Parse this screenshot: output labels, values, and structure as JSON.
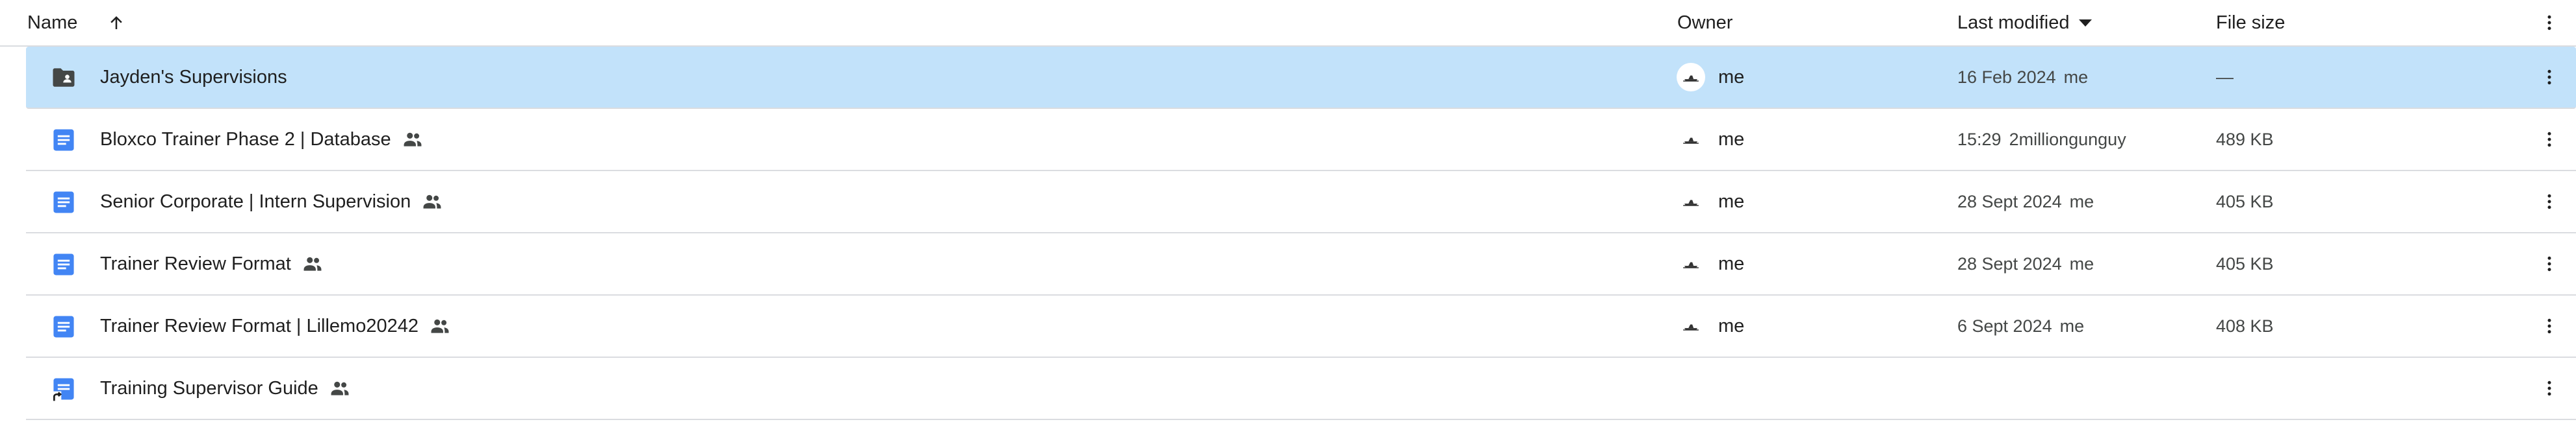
{
  "header": {
    "name_label": "Name",
    "owner_label": "Owner",
    "modified_label": "Last modified",
    "size_label": "File size"
  },
  "icons": {
    "folder": "shared-folder-icon",
    "doc": "google-doc-icon",
    "doc_shortcut": "google-doc-shortcut-icon",
    "shared": "people-icon",
    "more": "more-vert-icon",
    "sort": "arrow-up-icon"
  },
  "colors": {
    "selected_row": "#c2e2fa",
    "doc_blue": "#4285f4",
    "folder_dark": "#444746",
    "divider": "#dadce0"
  },
  "rows": [
    {
      "name": "Jayden's Supervisions",
      "type": "folder",
      "shared": false,
      "owner": "me",
      "modified_date": "16 Feb 2024",
      "modified_by": "me",
      "size": "—",
      "selected": true
    },
    {
      "name": "Bloxco Trainer Phase 2 | Database",
      "type": "doc",
      "shared": true,
      "owner": "me",
      "modified_date": "15:29",
      "modified_by": "2milliongunguy",
      "size": "489 KB",
      "selected": false
    },
    {
      "name": "Senior Corporate | Intern Supervision",
      "type": "doc",
      "shared": true,
      "owner": "me",
      "modified_date": "28 Sept 2024",
      "modified_by": "me",
      "size": "405 KB",
      "selected": false
    },
    {
      "name": "Trainer Review Format",
      "type": "doc",
      "shared": true,
      "owner": "me",
      "modified_date": "28 Sept 2024",
      "modified_by": "me",
      "size": "405 KB",
      "selected": false
    },
    {
      "name": "Trainer Review Format | Lillemo20242",
      "type": "doc",
      "shared": true,
      "owner": "me",
      "modified_date": "6 Sept 2024",
      "modified_by": "me",
      "size": "408 KB",
      "selected": false
    },
    {
      "name": "Training Supervisor Guide",
      "type": "doc_shortcut",
      "shared": true,
      "owner": "",
      "modified_date": "",
      "modified_by": "",
      "size": "",
      "selected": false
    }
  ]
}
